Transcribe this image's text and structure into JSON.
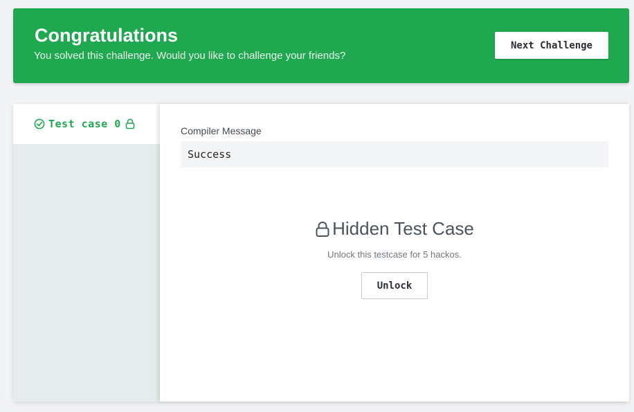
{
  "banner": {
    "title": "Congratulations",
    "subtitle": "You solved this challenge. Would you like to challenge your friends?",
    "next_button": "Next Challenge",
    "color": "#1fa84f"
  },
  "sidebar": {
    "tabs": [
      {
        "label": "Test case 0",
        "status_icon": "check-circle-icon",
        "lock_icon": "lock-icon",
        "state": "passed"
      }
    ]
  },
  "compiler": {
    "label": "Compiler Message",
    "message": "Success"
  },
  "hidden_case": {
    "title": "Hidden Test Case",
    "subtitle": "Unlock this testcase for 5 hackos.",
    "unlock_button": "Unlock"
  }
}
